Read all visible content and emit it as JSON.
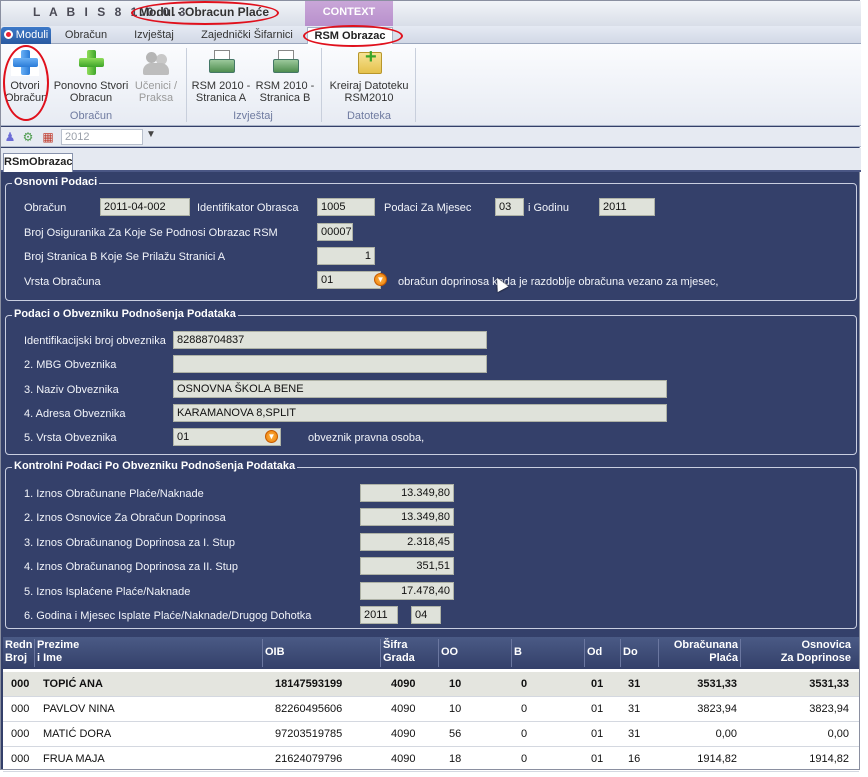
{
  "titlebar": {
    "app_title": "L A B I S  8 1.0.0.3",
    "module_title": "Modul - Obracun Plaće",
    "context_label": "CONTEXT"
  },
  "ribbon_tabs": [
    "Moduli",
    "Obračun",
    "Izvještaj",
    "Zajednički Šifarnici",
    "RSM Obrazac"
  ],
  "ribbon": {
    "buttons": [
      {
        "line1": "Otvori",
        "line2": "Obračun",
        "icon": "add-blue-icon"
      },
      {
        "line1": "Ponovno Stvori",
        "line2": "Obracun",
        "icon": "add-green-icon"
      },
      {
        "line1": "Učenici /",
        "line2": "Praksa",
        "icon": "people-icon"
      },
      {
        "line1": "RSM 2010 -",
        "line2": "Stranica A",
        "icon": "printer-icon"
      },
      {
        "line1": "RSM 2010 -",
        "line2": "Stranica B",
        "icon": "printer-icon"
      },
      {
        "line1": "Kreiraj Datoteku",
        "line2": "RSM2010",
        "icon": "new-file-icon"
      }
    ],
    "groups": [
      "Obračun",
      "Izvještaj",
      "Datoteka"
    ]
  },
  "subbar": {
    "year_value": "2012"
  },
  "doc_tab": "RSmObrazac",
  "osnovni": {
    "title": "Osnovni Podaci",
    "obracun_label": "Obračun",
    "obracun_value": "2011-04-002",
    "identifikator_label": "Identifikator Obrasca",
    "identifikator_value": "1005",
    "mjesec_label": "Podaci Za Mjesec",
    "mjesec_value": "03",
    "godina_label": "i Godinu",
    "godina_value": "2011",
    "broj_osiguranika_label": "Broj Osiguranika Za Koje Se Podnosi Obrazac RSM",
    "broj_osiguranika_value": "00007",
    "broj_stranica_label": "Broj Stranica B Koje Se Prilažu Stranici A",
    "broj_stranica_value": "1",
    "vrsta_label": "Vrsta Obračuna",
    "vrsta_value": "01",
    "vrsta_desc": "obračun doprinosa kada je razdoblje obračuna vezano za mjesec,"
  },
  "obveznik": {
    "title": "Podaci o Obvezniku Podnošenja Podataka",
    "id_label": "Identifikacijski broj obveznika",
    "id_value": "82888704837",
    "mbg_label": "2. MBG Obveznika",
    "mbg_value": "",
    "naziv_label": "3. Naziv Obveznika",
    "naziv_value": "OSNOVNA ŠKOLA BENE",
    "adresa_label": "4. Adresa Obveznika",
    "adresa_value": "KARAMANOVA 8,SPLIT",
    "vrsta_label": "5. Vrsta Obveznika",
    "vrsta_value": "01",
    "vrsta_desc": "obveznik pravna osoba,"
  },
  "kontrolni": {
    "title": "Kontrolni Podaci Po Obvezniku Podnošenja Podataka",
    "rows": [
      {
        "label": "1. Iznos Obračunane Plaće/Naknade",
        "value": "13.349,80"
      },
      {
        "label": "2. Iznos Osnovice Za Obračun Doprinosa",
        "value": "13.349,80"
      },
      {
        "label": "3. Iznos Obračunanog Doprinosa za I. Stup",
        "value": "2.318,45"
      },
      {
        "label": "4. Iznos Obračunanog Doprinosa za II. Stup",
        "value": "351,51"
      },
      {
        "label": "5. Iznos Isplaćene Plaće/Naknade",
        "value": "17.478,40"
      }
    ],
    "isplata_label": "6. Godina i Mjesec Isplate Plaće/Naknade/Drugog Dohotka",
    "isplata_godina": "2011",
    "isplata_mjesec": "04"
  },
  "table": {
    "headers": {
      "redn_1": "Redn",
      "redn_2": "Broj",
      "prezime_1": "Prezime",
      "prezime_2": "i Ime",
      "oib": "OIB",
      "sifra_1": "Šifra",
      "sifra_2": "Grada",
      "oo": "OO",
      "b": "B",
      "od": "Od",
      "do": "Do",
      "placa_1": "Obračunana",
      "placa_2": "Plaća",
      "osnovica_1": "Osnovica",
      "osnovica_2": "Za Doprinose"
    },
    "rows": [
      {
        "redn": "000",
        "ime": "TOPIĆ ANA",
        "oib": "18147593199",
        "grad": "4090",
        "oo": "10",
        "b": "0",
        "od": "01",
        "do": "31",
        "placa": "3531,33",
        "osnovica": "3531,33"
      },
      {
        "redn": "000",
        "ime": "PAVLOV  NINA",
        "oib": "82260495606",
        "grad": "4090",
        "oo": "10",
        "b": "0",
        "od": "01",
        "do": "31",
        "placa": "3823,94",
        "osnovica": "3823,94"
      },
      {
        "redn": "000",
        "ime": "MATIĆ  DORA",
        "oib": "97203519785",
        "grad": "4090",
        "oo": "56",
        "b": "0",
        "od": "01",
        "do": "31",
        "placa": "0,00",
        "osnovica": "0,00"
      },
      {
        "redn": "000",
        "ime": "FRUA MAJA",
        "oib": "21624079796",
        "grad": "4090",
        "oo": "18",
        "b": "0",
        "od": "01",
        "do": "16",
        "placa": "1914,82",
        "osnovica": "1914,82"
      }
    ]
  }
}
